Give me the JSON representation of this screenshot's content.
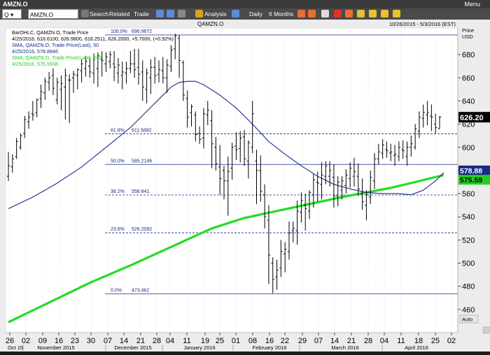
{
  "window": {
    "title": "AMZN.O",
    "menu_label": "Menu"
  },
  "toolbar": {
    "symbol_value": "AMZN.O",
    "search_label": "Search",
    "related_label": "Related",
    "trade_label": "Trade",
    "analysis_label": "Analysis",
    "interval_label": "Daily",
    "range_label": "6 Months"
  },
  "chart_header": {
    "symbol": "QAMZN.O",
    "date_range": "10/26/2015 - 5/3/2016 (EST)",
    "price_label_1": "Price",
    "price_label_2": "USD",
    "auto_label": "Auto"
  },
  "legend": {
    "ohlc_line1": "BarOHLC, QAMZN.O, Trade Price",
    "ohlc_line2": "4/25/2016, 616.6100, 626.9800, 616.2511, 626.2000, +5.7000, (+0.92%)",
    "sma50_line1": "SMA, QAMZN.O, Trade Price(Last), 50",
    "sma50_line2": "4/25/2016, 578.8846",
    "sma200_line1": "SMA, QAMZN.O, Trade Price(Last), 200",
    "sma200_line2": "4/25/2016, 575.5938"
  },
  "badges": {
    "last_price": "626.20",
    "sma50": "578.88",
    "sma200": "575.59",
    "last_color": "#000000",
    "sma50_color": "#1a2a8a",
    "sma200_color": "#22cc22"
  },
  "fib_levels": [
    {
      "pct": "100.0%",
      "label": "696.9672",
      "value": 696.9672,
      "style": "solid"
    },
    {
      "pct": "61.8%",
      "label": "611.5882",
      "value": 611.5882,
      "style": "dashed"
    },
    {
      "pct": "50.0%",
      "label": "585.2146",
      "value": 585.2146,
      "style": "solid"
    },
    {
      "pct": "38.2%",
      "label": "558.841",
      "value": 558.841,
      "style": "dashed"
    },
    {
      "pct": "23.6%",
      "label": "526.2092",
      "value": 526.2092,
      "style": "dashed"
    },
    {
      "pct": "0.0%",
      "label": "473.462",
      "value": 473.462,
      "style": "solid"
    }
  ],
  "chart_data": {
    "type": "line",
    "ylim": [
      440,
      703
    ],
    "yticks": [
      460,
      480,
      500,
      520,
      540,
      560,
      580,
      600,
      620,
      640,
      660,
      680
    ],
    "x_tick_labels": [
      "26",
      "02",
      "09",
      "16",
      "23",
      "30",
      "07",
      "14",
      "21",
      "28",
      "04",
      "11",
      "19",
      "25",
      "01",
      "08",
      "16",
      "22",
      "29",
      "07",
      "14",
      "21",
      "28",
      "04",
      "11",
      "18",
      "25",
      "02"
    ],
    "month_labels": [
      "Oct 15",
      "November 2015",
      "December 2015",
      "January 2016",
      "February 2016",
      "March 2016",
      "April 2016"
    ],
    "ohlc": [
      [
        575,
        596,
        571,
        584
      ],
      [
        583,
        594,
        578,
        590
      ],
      [
        592,
        608,
        590,
        605
      ],
      [
        600,
        612,
        598,
        610
      ],
      [
        612,
        627,
        608,
        624
      ],
      [
        622,
        631,
        616,
        626
      ],
      [
        629,
        640,
        623,
        628
      ],
      [
        630,
        642,
        626,
        641
      ],
      [
        642,
        654,
        634,
        648
      ],
      [
        647,
        660,
        641,
        657
      ],
      [
        656,
        665,
        649,
        660
      ],
      [
        662,
        668,
        645,
        651
      ],
      [
        641,
        660,
        637,
        656
      ],
      [
        650,
        662,
        632,
        655
      ],
      [
        652,
        668,
        624,
        662
      ],
      [
        658,
        663,
        621,
        658
      ],
      [
        660,
        666,
        647,
        663
      ],
      [
        662,
        668,
        650,
        667
      ],
      [
        666,
        676,
        656,
        672
      ],
      [
        668,
        679,
        661,
        674
      ],
      [
        670,
        678,
        660,
        665
      ],
      [
        664,
        681,
        655,
        676
      ],
      [
        668,
        682,
        652,
        679
      ],
      [
        676,
        683,
        661,
        675
      ],
      [
        672,
        682,
        665,
        678
      ],
      [
        674,
        683,
        668,
        680
      ],
      [
        672,
        683,
        657,
        669
      ],
      [
        664,
        677,
        655,
        671
      ],
      [
        662,
        674,
        650,
        665
      ],
      [
        664,
        674,
        655,
        668
      ],
      [
        668,
        683,
        664,
        672
      ],
      [
        672,
        685,
        660,
        667
      ],
      [
        669,
        685,
        654,
        663
      ],
      [
        665,
        675,
        640,
        652
      ],
      [
        650,
        668,
        638,
        664
      ],
      [
        660,
        676,
        646,
        669
      ],
      [
        669,
        678,
        655,
        662
      ],
      [
        663,
        675,
        656,
        667
      ],
      [
        666,
        678,
        655,
        660
      ],
      [
        660,
        676,
        647,
        671
      ],
      [
        670,
        688,
        665,
        684
      ],
      [
        685,
        698,
        676,
        696
      ],
      [
        694,
        697,
        660,
        675
      ],
      [
        673,
        675,
        640,
        645
      ],
      [
        642,
        649,
        617,
        626
      ],
      [
        630,
        637,
        618,
        635
      ],
      [
        628,
        631,
        605,
        611
      ],
      [
        612,
        618,
        603,
        607
      ],
      [
        608,
        634,
        599,
        629
      ],
      [
        628,
        640,
        619,
        632
      ],
      [
        623,
        632,
        582,
        603
      ],
      [
        600,
        609,
        580,
        586
      ],
      [
        583,
        602,
        559,
        573
      ],
      [
        580,
        584,
        555,
        571
      ],
      [
        571,
        592,
        541,
        579
      ],
      [
        582,
        604,
        572,
        600
      ],
      [
        601,
        613,
        589,
        598
      ],
      [
        599,
        614,
        587,
        608
      ],
      [
        609,
        615,
        584,
        590
      ],
      [
        588,
        606,
        573,
        604
      ],
      [
        600,
        640,
        595,
        629
      ],
      [
        588,
        598,
        551,
        580
      ],
      [
        580,
        593,
        553,
        562
      ],
      [
        559,
        568,
        530,
        540
      ],
      [
        537,
        550,
        482,
        507
      ],
      [
        500,
        505,
        474,
        486
      ],
      [
        488,
        503,
        477,
        494
      ],
      [
        496,
        520,
        488,
        510
      ],
      [
        508,
        518,
        492,
        512
      ],
      [
        510,
        536,
        503,
        526
      ],
      [
        528,
        536,
        518,
        530
      ],
      [
        528,
        554,
        516,
        545
      ],
      [
        544,
        561,
        535,
        554
      ],
      [
        550,
        560,
        528,
        547
      ],
      [
        545,
        563,
        538,
        561
      ],
      [
        559,
        577,
        548,
        572
      ],
      [
        570,
        579,
        553,
        569
      ],
      [
        568,
        587,
        555,
        576
      ],
      [
        575,
        588,
        568,
        584
      ],
      [
        575,
        588,
        566,
        580
      ],
      [
        574,
        585,
        548,
        558
      ],
      [
        558,
        575,
        549,
        570
      ],
      [
        563,
        575,
        555,
        571
      ],
      [
        567,
        581,
        560,
        576
      ],
      [
        573,
        587,
        565,
        582
      ],
      [
        575,
        591,
        566,
        579
      ],
      [
        575,
        586,
        558,
        564
      ],
      [
        560,
        573,
        546,
        553
      ],
      [
        550,
        563,
        537,
        559
      ],
      [
        557,
        580,
        551,
        574
      ],
      [
        571,
        595,
        564,
        590
      ],
      [
        590,
        603,
        585,
        596
      ],
      [
        595,
        607,
        590,
        602
      ],
      [
        598,
        605,
        591,
        597
      ],
      [
        595,
        603,
        588,
        596
      ],
      [
        593,
        602,
        584,
        594
      ],
      [
        592,
        605,
        588,
        600
      ],
      [
        598,
        606,
        590,
        597
      ],
      [
        592,
        605,
        584,
        600
      ],
      [
        600,
        610,
        592,
        603
      ],
      [
        600,
        620,
        598,
        616
      ],
      [
        614,
        631,
        608,
        626
      ],
      [
        625,
        637,
        617,
        630
      ],
      [
        628,
        640,
        619,
        630
      ],
      [
        627,
        637,
        614,
        626
      ],
      [
        620,
        629,
        612,
        617
      ],
      [
        616,
        627,
        616,
        626
      ]
    ],
    "sma50": [
      [
        0,
        547
      ],
      [
        6,
        557
      ],
      [
        12,
        569
      ],
      [
        18,
        583
      ],
      [
        24,
        600
      ],
      [
        30,
        617
      ],
      [
        34,
        631
      ],
      [
        38,
        645
      ],
      [
        40,
        652
      ],
      [
        42,
        656
      ],
      [
        44,
        657
      ],
      [
        46,
        657
      ],
      [
        48,
        654
      ],
      [
        52,
        645
      ],
      [
        56,
        634
      ],
      [
        60,
        620
      ],
      [
        64,
        605
      ],
      [
        68,
        594
      ],
      [
        72,
        584
      ],
      [
        76,
        575
      ],
      [
        80,
        568
      ],
      [
        84,
        564
      ],
      [
        88,
        561
      ],
      [
        92,
        560
      ],
      [
        96,
        560
      ],
      [
        99,
        559
      ],
      [
        102,
        563
      ],
      [
        105,
        571
      ],
      [
        107,
        578
      ]
    ],
    "sma200": [
      [
        0,
        449
      ],
      [
        10,
        466
      ],
      [
        20,
        483
      ],
      [
        30,
        498
      ],
      [
        40,
        514
      ],
      [
        50,
        530
      ],
      [
        58,
        539
      ],
      [
        66,
        545
      ],
      [
        74,
        551
      ],
      [
        82,
        557
      ],
      [
        88,
        561
      ],
      [
        94,
        565
      ],
      [
        100,
        570
      ],
      [
        107,
        576
      ]
    ]
  }
}
